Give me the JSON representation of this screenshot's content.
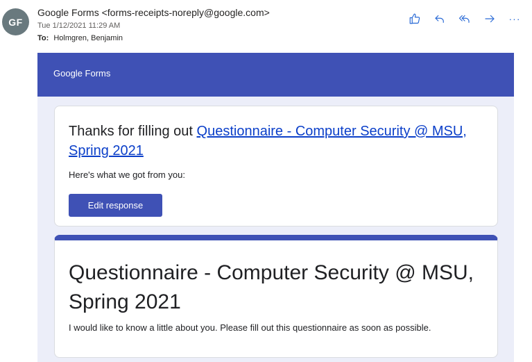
{
  "header": {
    "avatar_initials": "GF",
    "sender": "Google Forms <forms-receipts-noreply@google.com>",
    "date": "Tue 1/12/2021 11:29 AM",
    "to_label": "To:",
    "to_value": "Holmgren, Benjamin",
    "actions": {
      "like_icon": "thumbs-up-icon",
      "reply_icon": "reply-icon",
      "reply_all_icon": "reply-all-icon",
      "forward_icon": "forward-icon",
      "more_glyph": "···"
    }
  },
  "banner": {
    "title": "Google Forms"
  },
  "receipt": {
    "thanks_prefix": "Thanks for filling out ",
    "form_link": "Questionnaire - Computer Security @ MSU, Spring 2021",
    "got_from": "Here's what we got from you:",
    "edit_button": "Edit response"
  },
  "form": {
    "title": "Questionnaire - Computer Security @ MSU, Spring 2021",
    "description": "I would like to know a little about you. Please fill out this questionnaire as soon as possible."
  },
  "colors": {
    "accent": "#3f51b5",
    "background": "#eceef9",
    "link": "#0b3fc9",
    "action_icons": "#2b6bd6"
  }
}
